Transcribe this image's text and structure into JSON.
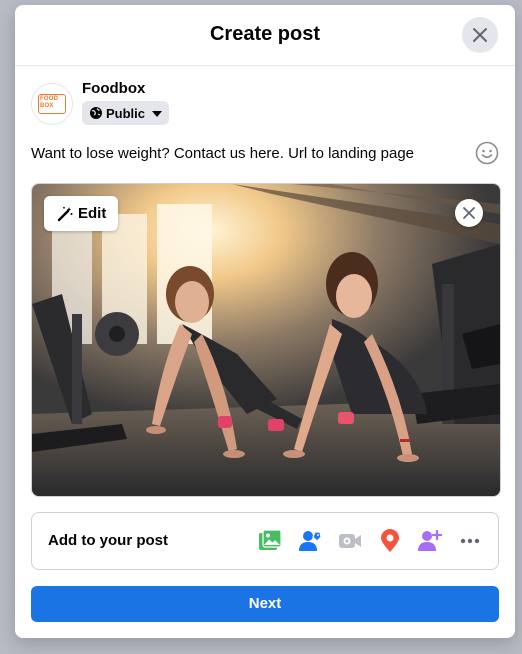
{
  "dialog": {
    "title": "Create post",
    "close_icon": "close-icon"
  },
  "author": {
    "name": "Foodbox",
    "avatar_text": "FOOD BOX",
    "privacy_label": "Public",
    "privacy_icon": "globe-icon"
  },
  "composer": {
    "text": "Want to lose weight? Contact us here. Url to landing page",
    "emoji_icon": "emoji-icon"
  },
  "attachment": {
    "edit_label": "Edit",
    "edit_icon": "magic-wand-icon",
    "remove_icon": "close-icon"
  },
  "add_to_post": {
    "label": "Add to your post",
    "icons": [
      "photo-video-icon",
      "tag-people-icon",
      "live-video-icon",
      "location-pin-icon",
      "add-person-icon",
      "more-icon"
    ]
  },
  "footer": {
    "next_label": "Next"
  },
  "colors": {
    "primary": "#1b74e4",
    "photo_green": "#45bd62",
    "tag_blue": "#1877f2",
    "live_gray": "#bcc0c4",
    "location_red": "#f5533d",
    "person_purple": "#a66ef2",
    "brand_orange": "#f07a2b"
  }
}
